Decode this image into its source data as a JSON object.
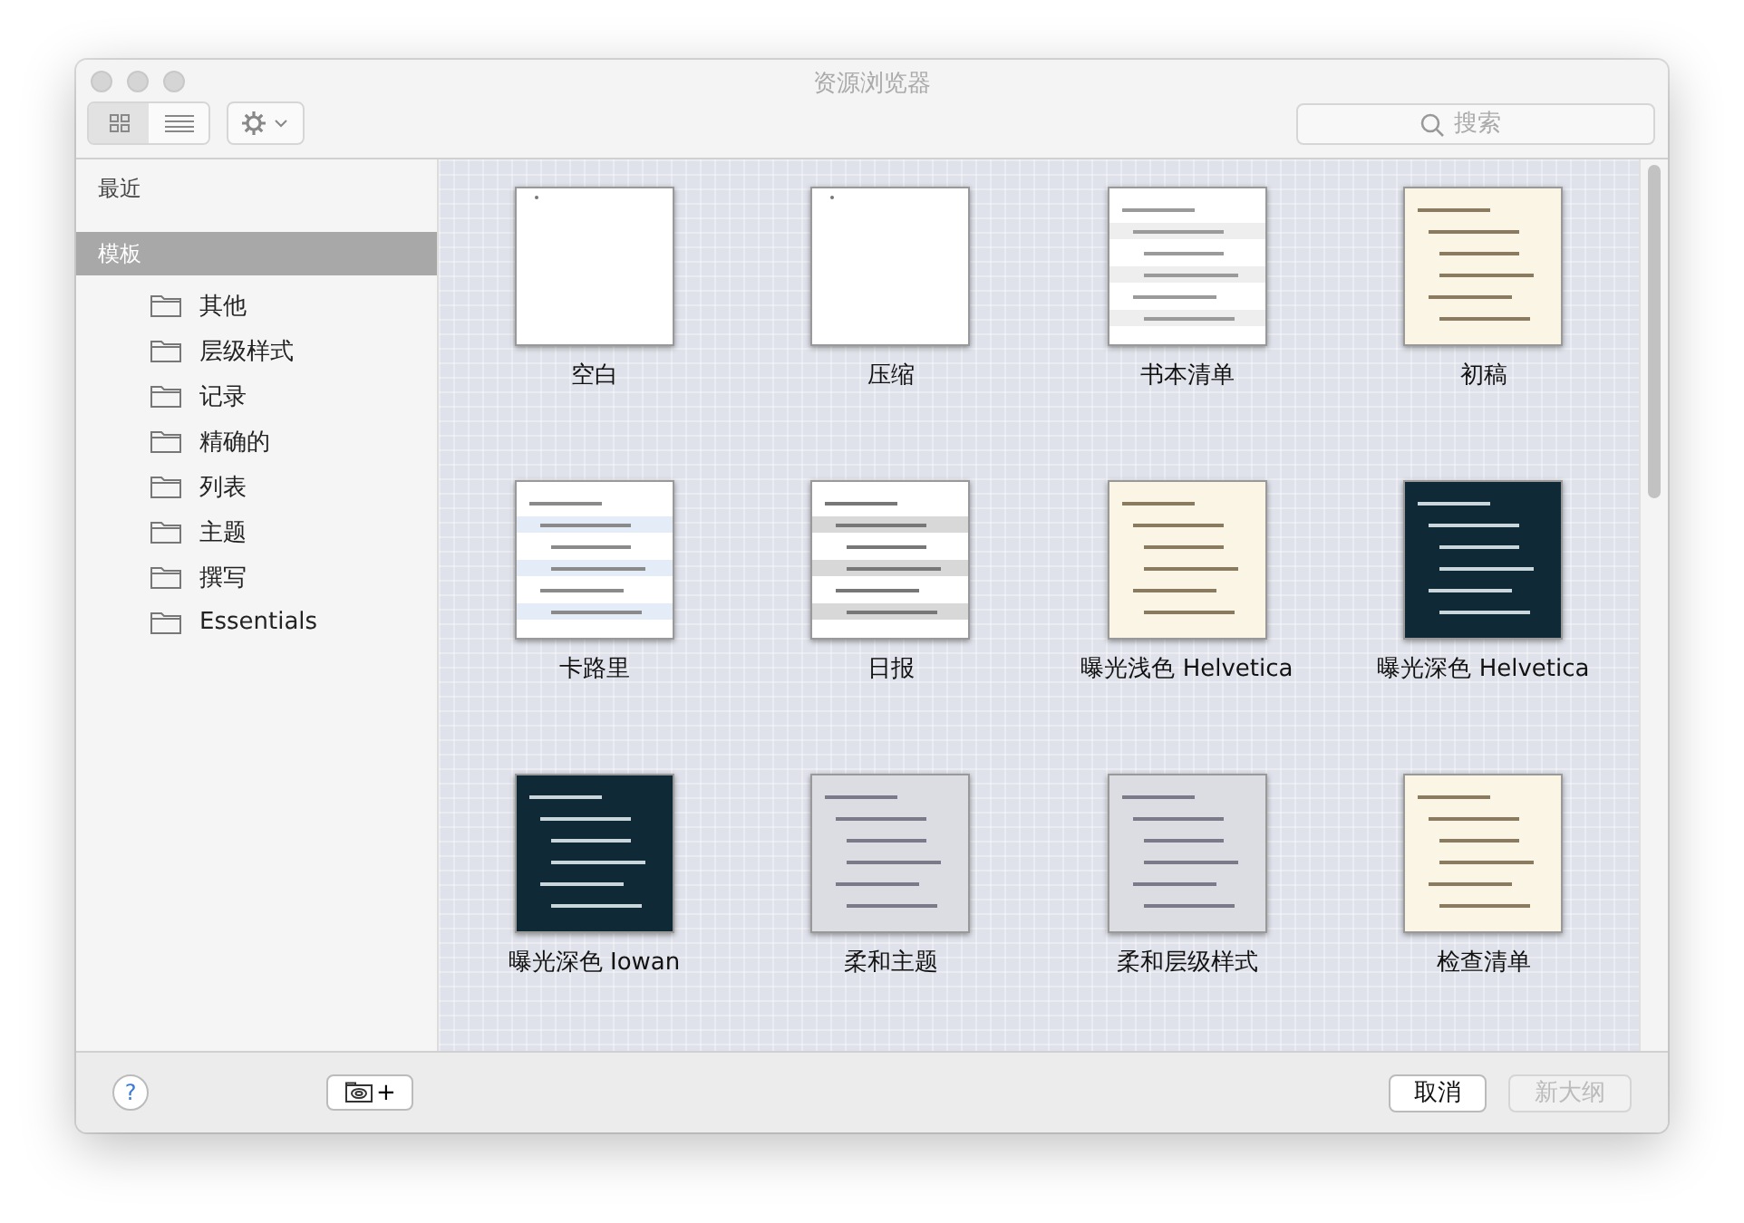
{
  "window": {
    "title": "资源浏览器"
  },
  "toolbar": {
    "view_modes": [
      {
        "kind": "grid",
        "selected": true
      },
      {
        "kind": "list",
        "selected": false
      }
    ],
    "search": {
      "placeholder": "搜索"
    }
  },
  "sidebar": {
    "items": [
      {
        "label": "最近",
        "selected": false
      },
      {
        "label": "模板",
        "selected": true,
        "children": [
          {
            "label": "其他"
          },
          {
            "label": "层级样式"
          },
          {
            "label": "记录"
          },
          {
            "label": "精确的"
          },
          {
            "label": "列表"
          },
          {
            "label": "主题"
          },
          {
            "label": "撰写"
          },
          {
            "label": "Essentials"
          }
        ]
      }
    ]
  },
  "templates": [
    {
      "label": "空白",
      "kind": "blank"
    },
    {
      "label": "压缩",
      "kind": "blank"
    },
    {
      "label": "书本清单",
      "kind": "list"
    },
    {
      "label": "初稿",
      "kind": "cream"
    },
    {
      "label": "卡路里",
      "kind": "stripes"
    },
    {
      "label": "日报",
      "kind": "gray"
    },
    {
      "label": "曝光浅色 Helvetica",
      "kind": "cream"
    },
    {
      "label": "曝光深色 Helvetica",
      "kind": "dark"
    },
    {
      "label": "曝光深色 Iowan",
      "kind": "dark"
    },
    {
      "label": "柔和主题",
      "kind": "soft"
    },
    {
      "label": "柔和层级样式",
      "kind": "soft"
    },
    {
      "label": "检查清单",
      "kind": "cream"
    }
  ],
  "footer": {
    "help": "?",
    "add_button": "+",
    "buttons": [
      {
        "label": "取消",
        "disabled": false
      },
      {
        "label": "新大纲",
        "disabled": true
      }
    ]
  }
}
